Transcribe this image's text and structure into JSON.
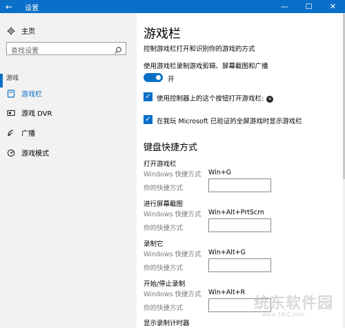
{
  "titlebar": {
    "back_glyph": "←",
    "title": "设置",
    "minimize": "—",
    "maximize": "☐",
    "close": "✕"
  },
  "sidebar": {
    "home_label": "主页",
    "search_placeholder": "查找设置",
    "section_label": "游戏",
    "items": [
      {
        "label": "游戏栏",
        "icon": "game-bar-icon",
        "selected": true
      },
      {
        "label": "游戏 DVR",
        "icon": "dvr-icon",
        "selected": false
      },
      {
        "label": "广播",
        "icon": "broadcast-icon",
        "selected": false
      },
      {
        "label": "游戏模式",
        "icon": "game-mode-icon",
        "selected": false
      }
    ]
  },
  "main": {
    "title": "游戏栏",
    "description": "控制游戏栏打开和识别你的游戏的方式",
    "toggle_label": "使用游戏栏录制游戏剪辑、屏幕截图和广播",
    "toggle_state": "开",
    "checkbox1_label": "使用控制器上的这个按钮打开游戏栏:",
    "checkbox2_label": "在我玩 Microsoft 已验证的全屏游戏时显示游戏栏",
    "shortcuts_title": "键盘快捷方式",
    "groups": [
      {
        "title": "打开游戏栏",
        "windows_label": "Windows 快捷方式",
        "windows_value": "Win+G",
        "yours_label": "你的快捷方式"
      },
      {
        "title": "进行屏幕截图",
        "windows_label": "Windows 快捷方式",
        "windows_value": "Win+Alt+PrtScrn",
        "yours_label": "你的快捷方式"
      },
      {
        "title": "录制它",
        "windows_label": "Windows 快捷方式",
        "windows_value": "Win+Alt+G",
        "yours_label": "你的快捷方式"
      },
      {
        "title": "开始/停止录制",
        "windows_label": "Windows 快捷方式",
        "windows_value": "Win+Alt+R",
        "yours_label": "你的快捷方式"
      }
    ],
    "last_group_title": "显示录制计时器"
  },
  "watermark": {
    "main": "统东软件园",
    "sub": "www.33LC.com"
  },
  "colors": {
    "accent": "#0a6fc8",
    "sidebar_bg": "#f2f2f2"
  }
}
